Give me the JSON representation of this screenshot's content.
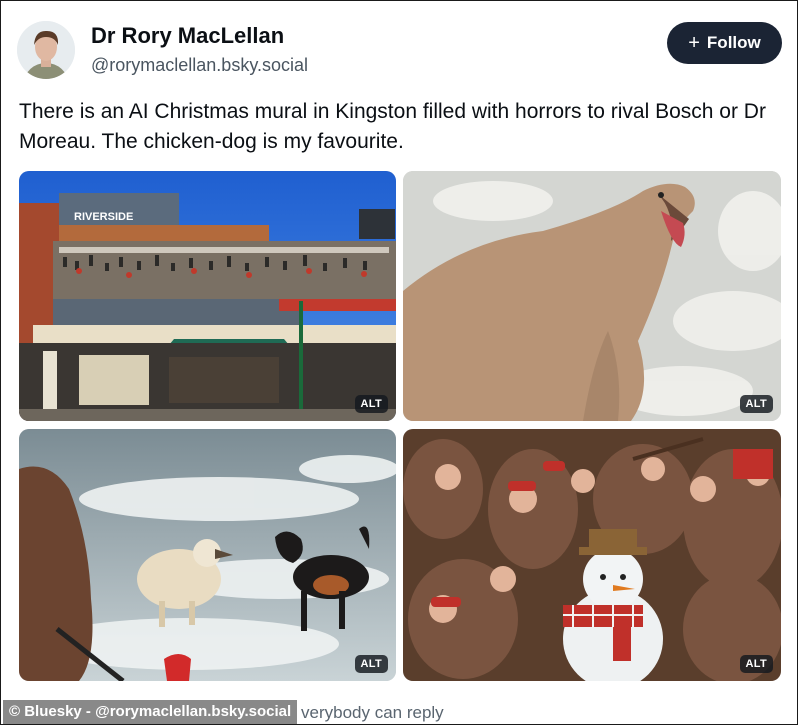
{
  "post": {
    "author": {
      "display_name": "Dr Rory MacLellan",
      "handle": "@rorymaclellan.bsky.social"
    },
    "follow_label": "Follow",
    "text": "There is an AI Christmas mural in Kingston filled with horrors to rival Bosch or Dr Moreau. The chicken-dog is my favourite.",
    "images": [
      {
        "alt_label": "ALT",
        "sign_text": "RIVERSIDE"
      },
      {
        "alt_label": "ALT"
      },
      {
        "alt_label": "ALT"
      },
      {
        "alt_label": "ALT"
      }
    ],
    "reply_note": "verybody can reply"
  },
  "watermark": "© Bluesky - @rorymaclellan.bsky.social",
  "icons": {
    "follow": "plus-icon"
  }
}
